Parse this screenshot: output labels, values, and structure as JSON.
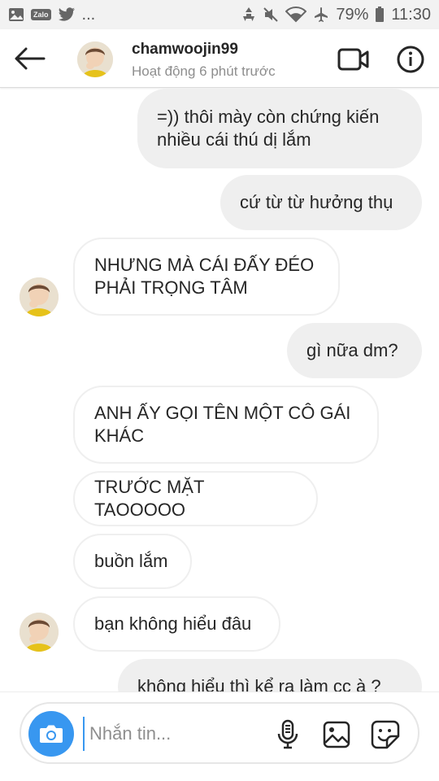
{
  "status_bar": {
    "notif_icons": [
      "image-icon",
      "zalo-icon",
      "twitter-icon"
    ],
    "zalo_label": "Zalo",
    "more": "...",
    "status_icons": [
      "recycle-icon",
      "mute-icon",
      "wifi-icon",
      "airplane-icon"
    ],
    "battery": "79%",
    "time": "11:30"
  },
  "header": {
    "username": "chamwoojin99",
    "activity": "Hoạt động 6 phút trước",
    "back_icon": "back-arrow-icon",
    "video_icon": "video-call-icon",
    "info_icon": "info-icon"
  },
  "messages": [
    {
      "side": "out",
      "text": "=)) thôi mày còn chứng kiến nhiều cái thú dị lắm"
    },
    {
      "side": "out",
      "text": "cứ từ từ hưởng thụ"
    },
    {
      "side": "in",
      "text": "NHƯNG MÀ CÁI ĐẤY ĐÉO PHẢI TRỌNG TÂM",
      "avatar": true
    },
    {
      "side": "out",
      "text": "gì nữa dm?"
    },
    {
      "side": "in",
      "text": "ANH ẤY GỌI TÊN MỘT CÔ GÁI KHÁC"
    },
    {
      "side": "in",
      "text": "TRƯỚC MẶT TAOOOOO"
    },
    {
      "side": "in",
      "text": "buồn lắm"
    },
    {
      "side": "in",
      "text": "bạn không hiểu đâu",
      "avatar": true
    },
    {
      "side": "out",
      "text": "không hiểu thì kể ra làm cc à ?"
    }
  ],
  "composer": {
    "placeholder": "Nhắn tin...",
    "value": "",
    "icons": [
      "camera-icon",
      "microphone-icon",
      "gallery-icon",
      "sticker-icon"
    ]
  },
  "colors": {
    "accent": "#3897f0",
    "outgoing_bubble": "#efefef",
    "incoming_border": "#efefef",
    "status_bar_bg": "#f2f2f2"
  }
}
